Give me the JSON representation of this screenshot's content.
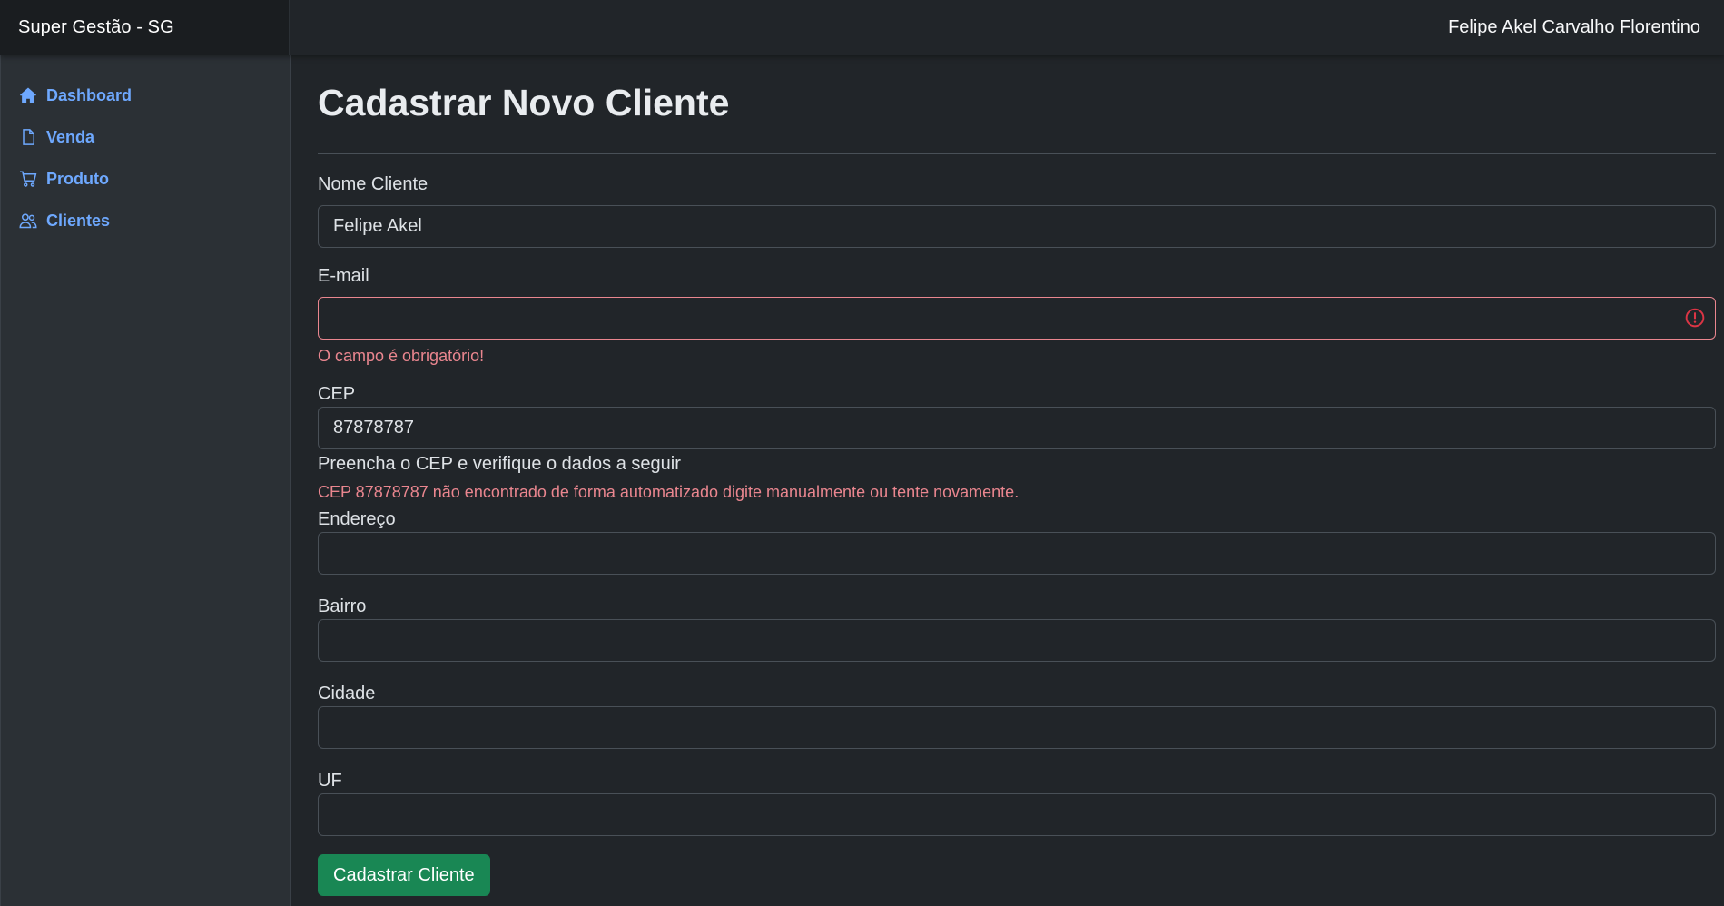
{
  "header": {
    "brand": "Super Gestão - SG",
    "user_name": "Felipe Akel Carvalho Florentino"
  },
  "sidebar": {
    "items": [
      {
        "label": "Dashboard",
        "icon": "house-icon"
      },
      {
        "label": "Venda",
        "icon": "file-icon"
      },
      {
        "label": "Produto",
        "icon": "cart-icon"
      },
      {
        "label": "Clientes",
        "icon": "people-icon"
      }
    ]
  },
  "page": {
    "title": "Cadastrar Novo Cliente"
  },
  "form": {
    "nome": {
      "label": "Nome Cliente",
      "value": "Felipe Akel"
    },
    "email": {
      "label": "E-mail",
      "value": "",
      "error": "O campo é obrigatório!"
    },
    "cep": {
      "label": "CEP",
      "value": "87878787",
      "help": "Preencha o CEP e verifique o dados a seguir",
      "error": "CEP 87878787 não encontrado de forma automatizado digite manualmente ou tente novamente."
    },
    "endereco": {
      "label": "Endereço",
      "value": ""
    },
    "bairro": {
      "label": "Bairro",
      "value": ""
    },
    "cidade": {
      "label": "Cidade",
      "value": ""
    },
    "uf": {
      "label": "UF",
      "value": ""
    },
    "submit_label": "Cadastrar Cliente"
  },
  "colors": {
    "background": "#212529",
    "sidebar": "#2b3035",
    "link": "#6ea8fe",
    "danger": "#ea868f",
    "success": "#198754"
  }
}
